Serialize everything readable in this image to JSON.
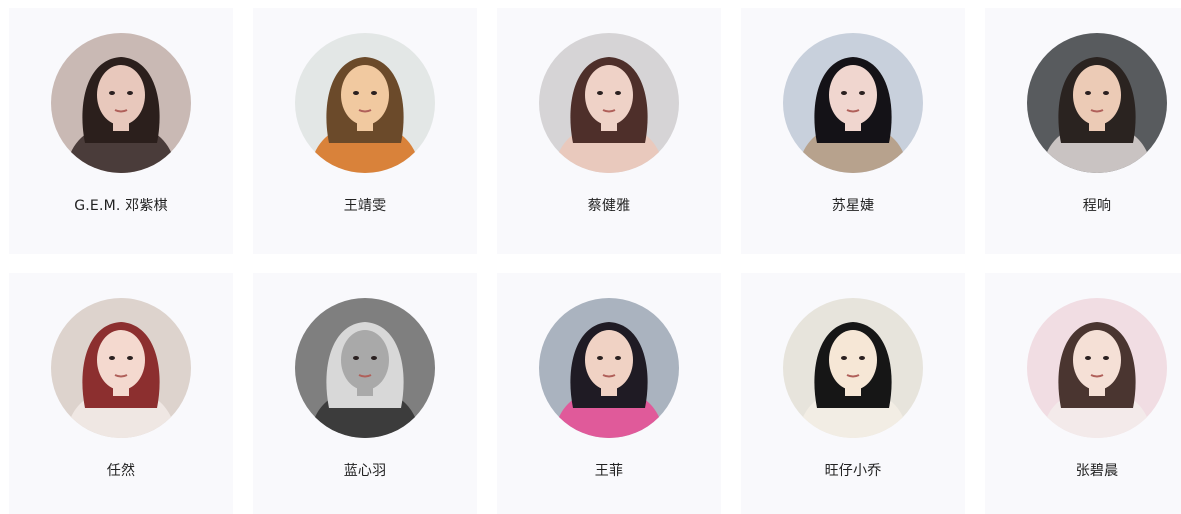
{
  "artists": [
    {
      "name": "G.E.M. 邓紫棋",
      "avatar_bg": "#c9b9b4",
      "hair": "#2b1f1c",
      "skin": "#e8c8bc",
      "cloth": "#4a3c3a"
    },
    {
      "name": "王靖雯",
      "avatar_bg": "#e3e7e6",
      "hair": "#6b4a2a",
      "skin": "#f1c9a0",
      "cloth": "#d9823a"
    },
    {
      "name": "蔡健雅",
      "avatar_bg": "#d6d4d6",
      "hair": "#4e2f2a",
      "skin": "#efd2c7",
      "cloth": "#e9c9bd"
    },
    {
      "name": "苏星婕",
      "avatar_bg": "#c8d0dc",
      "hair": "#141217",
      "skin": "#f0d6cf",
      "cloth": "#b7a28d"
    },
    {
      "name": "程响",
      "avatar_bg": "#585b5e",
      "hair": "#2a2320",
      "skin": "#eccbb6",
      "cloth": "#c9c3c2"
    },
    {
      "name": "任然",
      "avatar_bg": "#ddd3cd",
      "hair": "#8c2f2f",
      "skin": "#f4d9cf",
      "cloth": "#efe7e3"
    },
    {
      "name": "蓝心羽",
      "avatar_bg": "#7f7f7f",
      "hair": "#d8d8d8",
      "skin": "#a9a9a9",
      "cloth": "#3c3c3c"
    },
    {
      "name": "王菲",
      "avatar_bg": "#aab3bf",
      "hair": "#1f1b24",
      "skin": "#f0d2c4",
      "cloth": "#e05a9a"
    },
    {
      "name": "旺仔小乔",
      "avatar_bg": "#e7e4dc",
      "hair": "#161616",
      "skin": "#f6e7d6",
      "cloth": "#f2ede4"
    },
    {
      "name": "张碧晨",
      "avatar_bg": "#f1dde3",
      "hair": "#4a3530",
      "skin": "#f5e0d6",
      "cloth": "#f3eaea"
    }
  ]
}
